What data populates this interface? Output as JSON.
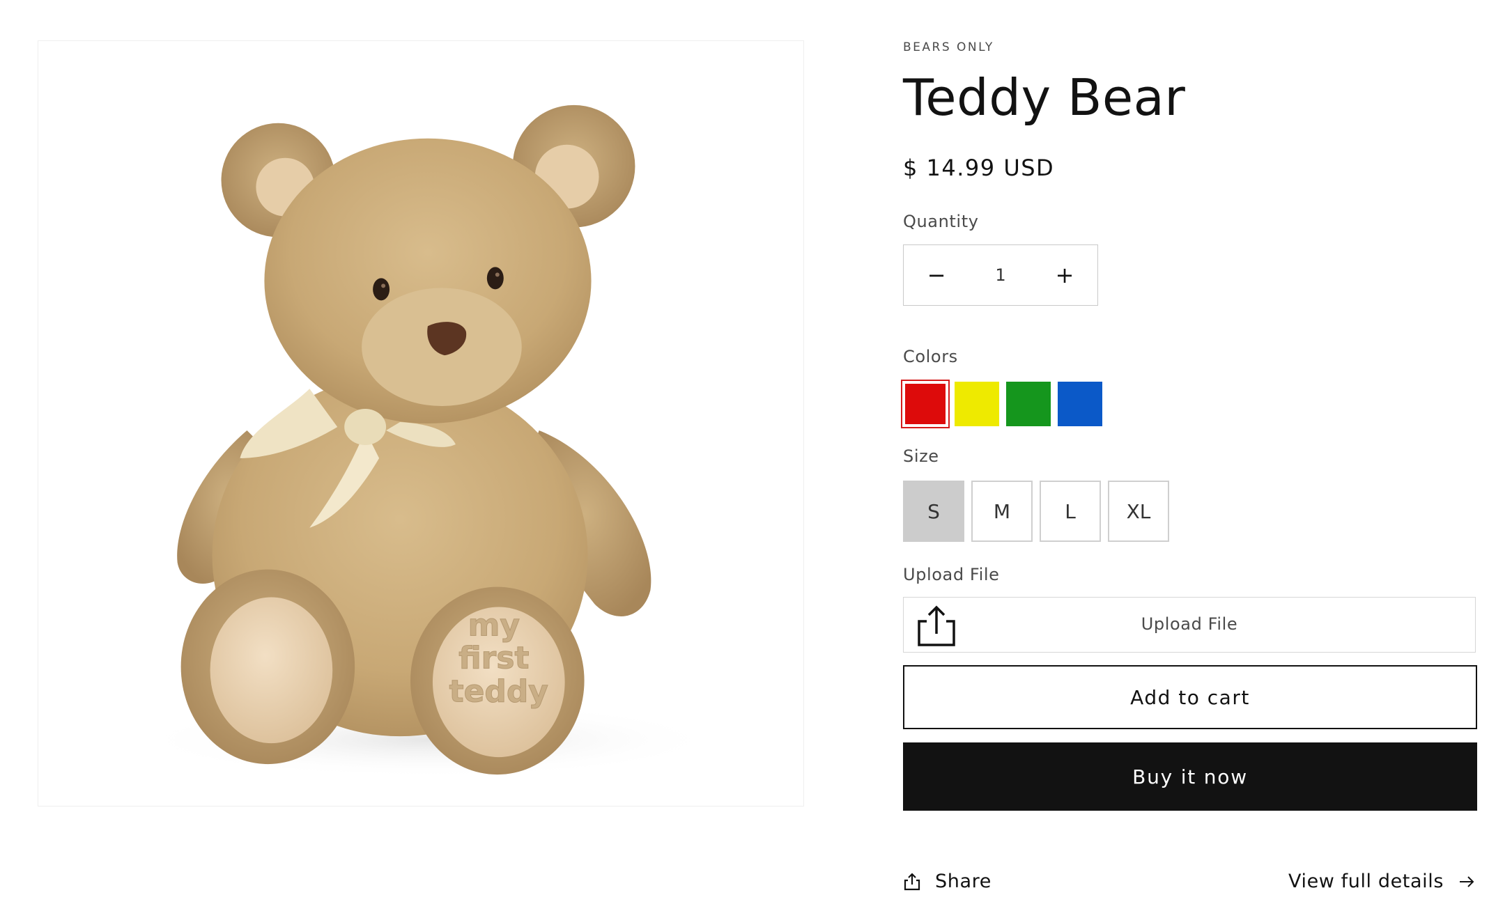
{
  "product": {
    "vendor": "BEARS ONLY",
    "title": "Teddy Bear",
    "price": "$ 14.99 USD",
    "image_alt": "Tan plush teddy bear with cream ribbon, \"my first teddy\" stitched on foot",
    "image_foot_text": [
      "my",
      "first",
      "teddy"
    ]
  },
  "quantity": {
    "label": "Quantity",
    "value": "1",
    "minus_label": "−",
    "plus_label": "+"
  },
  "colors": {
    "label": "Colors",
    "options": [
      {
        "name": "red",
        "hex": "#dd0b0b",
        "selected": true
      },
      {
        "name": "yellow",
        "hex": "#eeea00"
      },
      {
        "name": "green",
        "hex": "#15961d"
      },
      {
        "name": "blue",
        "hex": "#0b59c8"
      }
    ]
  },
  "size": {
    "label": "Size",
    "options": [
      "S",
      "M",
      "L",
      "XL"
    ],
    "selected": "S"
  },
  "upload": {
    "label": "Upload File",
    "button_text": "Upload File",
    "icon": "upload-icon"
  },
  "actions": {
    "add_to_cart": "Add to cart",
    "buy_now": "Buy it now"
  },
  "footer": {
    "share_label": "Share",
    "share_icon": "share-icon",
    "details_label": "View full details",
    "details_icon": "arrow-right-icon"
  }
}
